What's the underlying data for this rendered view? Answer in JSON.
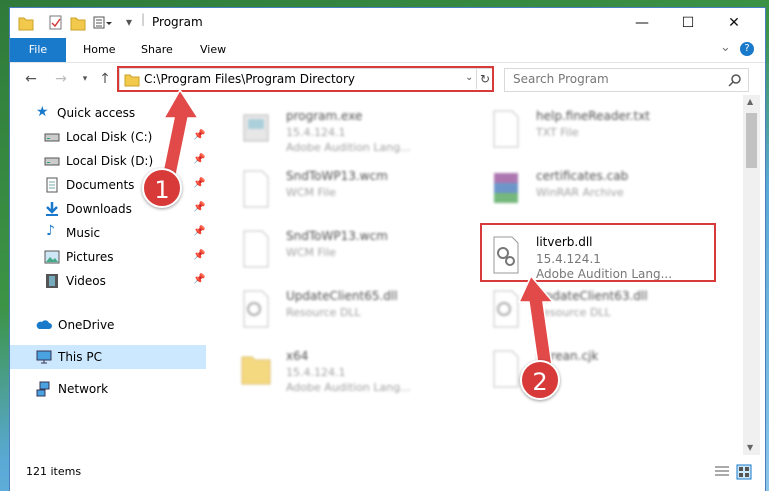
{
  "window": {
    "title": "Program",
    "controls": {
      "minimize": "—",
      "maximize": "☐",
      "close": "✕"
    }
  },
  "ribbon": {
    "tabs": [
      "File",
      "Home",
      "Share",
      "View"
    ],
    "expand": "⌄",
    "help": "?"
  },
  "address": {
    "path": "C:\\Program Files\\Program Directory",
    "refresh": "↻"
  },
  "search": {
    "placeholder": "Search Program"
  },
  "sidebar": {
    "items": [
      {
        "label": "Quick access",
        "icon": "star-icon"
      },
      {
        "label": "Local Disk (C:)",
        "icon": "drive-icon"
      },
      {
        "label": "Local Disk (D:)",
        "icon": "drive-icon"
      },
      {
        "label": "Documents",
        "icon": "documents-icon"
      },
      {
        "label": "Downloads",
        "icon": "download-icon"
      },
      {
        "label": "Music",
        "icon": "music-icon"
      },
      {
        "label": "Pictures",
        "icon": "pictures-icon"
      },
      {
        "label": "Videos",
        "icon": "videos-icon"
      },
      {
        "label": "OneDrive",
        "icon": "cloud-icon"
      },
      {
        "label": "This PC",
        "icon": "pc-icon"
      },
      {
        "label": "Network",
        "icon": "network-icon"
      }
    ]
  },
  "files": [
    {
      "name": "program.exe",
      "line2": "15.4.124.1",
      "line3": "Adobe Audition Lang..."
    },
    {
      "name": "help.fineReader.txt",
      "line2": "TXT File",
      "line3": ""
    },
    {
      "name": "SndToWP13.wcm",
      "line2": "WCM File",
      "line3": ""
    },
    {
      "name": "certificates.cab",
      "line2": "WinRAR Archive",
      "line3": ""
    },
    {
      "name": "SndToWP13.wcm",
      "line2": "WCM File",
      "line3": ""
    },
    {
      "name": "litverb.dll",
      "line2": "15.4.124.1",
      "line3": "Adobe Audition Lang..."
    },
    {
      "name": "UpdateClient65.dll",
      "line2": "Resource DLL",
      "line3": ""
    },
    {
      "name": "UpdateClient63.dll",
      "line2": "Resource DLL",
      "line3": ""
    },
    {
      "name": "x64",
      "line2": "15.4.124.1",
      "line3": "Adobe Audition Lang..."
    },
    {
      "name": "Korean.cjk",
      "line2": "",
      "line3": ""
    }
  ],
  "status": {
    "count": "121 items"
  },
  "annotations": {
    "step1": "1",
    "step2": "2"
  },
  "colors": {
    "accent": "#1979ca",
    "highlight": "#d83a3a",
    "selected": "#cce8ff"
  }
}
